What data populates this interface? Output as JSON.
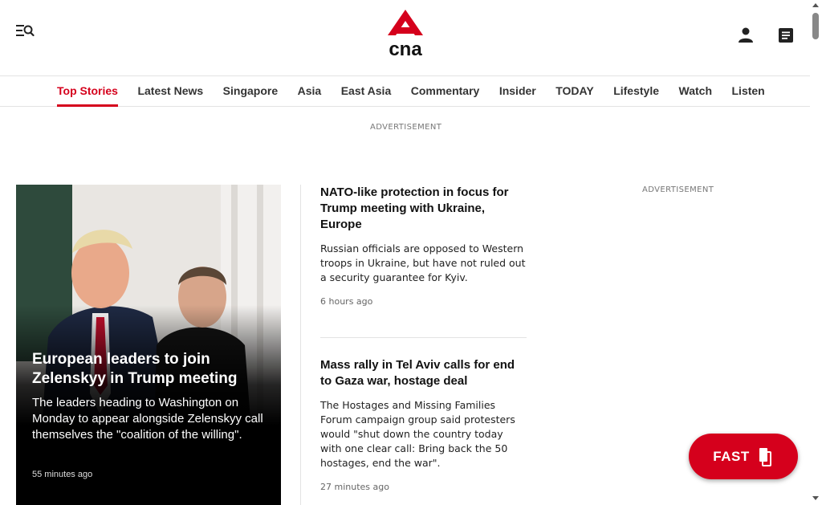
{
  "header": {
    "logo_text": "cna",
    "menu_icon": "menu-search-icon",
    "user_icon": "user-icon",
    "doc_icon": "document-icon"
  },
  "nav": {
    "items": [
      {
        "label": "Top Stories",
        "active": true
      },
      {
        "label": "Latest News"
      },
      {
        "label": "Singapore"
      },
      {
        "label": "Asia"
      },
      {
        "label": "East Asia"
      },
      {
        "label": "Commentary"
      },
      {
        "label": "Insider"
      },
      {
        "label": "TODAY"
      },
      {
        "label": "Lifestyle"
      },
      {
        "label": "Watch"
      },
      {
        "label": "Listen"
      }
    ]
  },
  "ads": {
    "top_label": "ADVERTISEMENT",
    "side_label": "ADVERTISEMENT"
  },
  "hero": {
    "title": "European leaders to join Zelenskyy in Trump meeting",
    "summary": "The leaders heading to Washington on Monday to appear alongside Zelenskyy call themselves the \"coalition of the willing\".",
    "time": "55 minutes ago"
  },
  "stories": [
    {
      "title": "NATO-like protection in focus for Trump meeting with Ukraine, Europe",
      "summary": "Russian officials are opposed to Western troops in Ukraine, but have not ruled out a security guarantee for Kyiv.",
      "time": "6 hours ago"
    },
    {
      "title": "Mass rally in Tel Aviv calls for end to Gaza war, hostage deal",
      "summary": "The Hostages and Missing Families Forum campaign group said protesters would \"shut down the country today with one clear call: Bring back the 50 hostages, end the war\".",
      "time": "27 minutes ago"
    }
  ],
  "fast": {
    "label": "FAST",
    "icon": "cards-stack-icon"
  },
  "colors": {
    "brand_red": "#d5001c",
    "text": "#111111",
    "muted": "#666666"
  }
}
